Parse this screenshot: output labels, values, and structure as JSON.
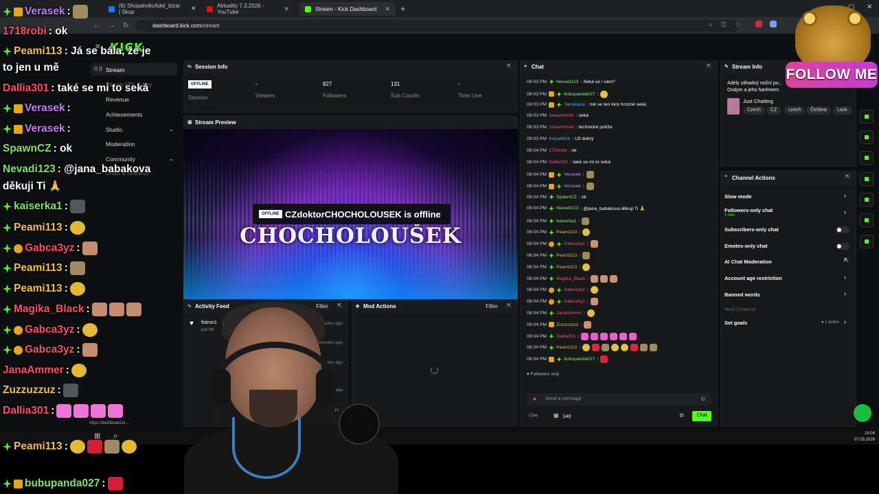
{
  "browser": {
    "tabs": [
      {
        "label": "(6) ShopaholicAdel_bizar | Skup",
        "active": false
      },
      {
        "label": "Aktuality 7.3.2026 - YouTube",
        "active": false
      },
      {
        "label": "Stream - Kick Dashboard",
        "active": true
      }
    ],
    "url_host": "dashboard.kick.com",
    "url_path": "/stream"
  },
  "sidebar": {
    "logo": "KICK",
    "items": [
      {
        "label": "Stream",
        "active": true
      },
      {
        "label": "Stream URL & Key"
      },
      {
        "label": "Revenue"
      },
      {
        "label": "Achievements"
      },
      {
        "label": "Studio"
      },
      {
        "label": "Moderation"
      },
      {
        "label": "Community"
      },
      {
        "label": "Drops & Rewards"
      }
    ],
    "link_preview": "https://dashboard.ki..."
  },
  "session_info": {
    "title": "Session Info",
    "status_badge": "OFFLINE",
    "session_label": "Session",
    "viewers_value": "-",
    "viewers_label": "Viewers",
    "followers_value": "827",
    "followers_label": "Followers",
    "subs_value": "131",
    "subs_label": "Sub Counts",
    "time_value": "-",
    "time_label": "Time Live"
  },
  "stream_preview": {
    "title": "Stream Preview",
    "overlay_title": "CHOCHOLOUŠEK",
    "offline_badge": "OFFLINE",
    "offline_text": "CZdoktorCHOCHOLOUSEK is offline"
  },
  "activity_feed": {
    "title": "Activity Feed",
    "filter": "Filter",
    "items": [
      {
        "name": "fistron1",
        "sub": "just foll",
        "time": "4 minutes ago"
      },
      {
        "name": "",
        "sub": "",
        "time": "6 minutes ago"
      },
      {
        "name": "",
        "sub": "",
        "time": "9 minutes ago"
      },
      {
        "name": "",
        "sub": "",
        "time": "19 minutes ago"
      },
      {
        "name": "",
        "sub": "",
        "time": "ago"
      }
    ]
  },
  "mod_actions": {
    "title": "Mod Actions",
    "filter": "Filter"
  },
  "chat": {
    "title": "Chat",
    "messages": [
      {
        "time": "08:03 PM",
        "user": "Nevadi123",
        "color": "#8cf06a",
        "text": ": Seká se i vám?"
      },
      {
        "time": "08:03 PM",
        "user": "bubupanda027",
        "color": "#8cf06a",
        "text": ":"
      },
      {
        "time": "08:03 PM",
        "user": "Tamalazia",
        "color": "#5aa7ff",
        "text": ": mě se ten kick hrozně seká"
      },
      {
        "time": "08:03 PM",
        "user": "JanaAmmer",
        "color": "#ff4e6a",
        "text": ": seká"
      },
      {
        "time": "08:03 PM",
        "user": "JanaAmmer",
        "color": "#ff4e6a",
        "text": ": technické potíže"
      },
      {
        "time": "08:03 PM",
        "user": "IndyaWick",
        "color": "#5aa7ff",
        "text": ": Už dobrý"
      },
      {
        "time": "08:04 PM",
        "user": "1718robi",
        "color": "#ff4e6a",
        "text": ": ok"
      },
      {
        "time": "08:04 PM",
        "user": "Dallia301",
        "color": "#ff4e6a",
        "text": ": také se mi to seká"
      },
      {
        "time": "08:04 PM",
        "user": "Verasek",
        "color": "#c18bff",
        "text": ":"
      },
      {
        "time": "08:04 PM",
        "user": "Verasek",
        "color": "#c18bff",
        "text": ":"
      },
      {
        "time": "08:04 PM",
        "user": "SpawnCZ",
        "color": "#8cf06a",
        "text": ": ok"
      },
      {
        "time": "08:04 PM",
        "user": "Nevadi123",
        "color": "#8cf06a",
        "text": ": @jana_babakova děkuji Ti 🙏"
      },
      {
        "time": "08:04 PM",
        "user": "kaiserka1",
        "color": "#8cf06a",
        "text": ":"
      },
      {
        "time": "08:04 PM",
        "user": "Peami113",
        "color": "#e6b84a",
        "text": ":"
      },
      {
        "time": "08:04 PM",
        "user": "Gabca3yz",
        "color": "#ff4e6a",
        "text": ":"
      },
      {
        "time": "08:04 PM",
        "user": "Peami113",
        "color": "#e6b84a",
        "text": ":"
      },
      {
        "time": "08:04 PM",
        "user": "Peami113",
        "color": "#e6b84a",
        "text": ":"
      },
      {
        "time": "08:04 PM",
        "user": "Magika_Black",
        "color": "#ff4e6a",
        "text": ":"
      },
      {
        "time": "08:04 PM",
        "user": "Gabca3yz",
        "color": "#ff4e6a",
        "text": ":"
      },
      {
        "time": "08:04 PM",
        "user": "Gabca3yz",
        "color": "#ff4e6a",
        "text": ":"
      },
      {
        "time": "08:04 PM",
        "user": "JanaAmmer",
        "color": "#ff4e6a",
        "text": ":"
      },
      {
        "time": "08:04 PM",
        "user": "Zuzzuzzuz",
        "color": "#e6b84a",
        "text": ":"
      },
      {
        "time": "08:04 PM",
        "user": "Dallia301",
        "color": "#ff4e6a",
        "text": ":"
      },
      {
        "time": "08:04 PM",
        "user": "Peami113",
        "color": "#e6b84a",
        "text": ":"
      },
      {
        "time": "08:04 PM",
        "user": "bubupanda027",
        "color": "#8cf06a",
        "text": ":"
      }
    ],
    "followers_only": "Followers only",
    "input_placeholder": "Send a message",
    "viewer_count": "140",
    "chat_button": "Chat"
  },
  "stream_info": {
    "title": "Stream Info",
    "stream_title": "Adély záhadný noční po... Ondym a jeho harémem",
    "category": "Just Chatting",
    "tags": [
      "Czech",
      "CZ",
      "czech",
      "Čeština",
      "Lock"
    ]
  },
  "channel_actions": {
    "title": "Channel Actions",
    "items": [
      {
        "label": "Slow mode",
        "kind": "chevron"
      },
      {
        "label": "Followers-only chat",
        "sub": "1 min",
        "kind": "chevron"
      },
      {
        "label": "Subscribers-only chat",
        "kind": "toggle"
      },
      {
        "label": "Emotes-only chat",
        "kind": "toggle"
      },
      {
        "label": "AI Chat Moderation",
        "kind": "external"
      },
      {
        "label": "Account age restriction",
        "kind": "chevron"
      },
      {
        "label": "Banned words",
        "kind": "chevron"
      },
      {
        "label": "Host Channel",
        "kind": "disabled"
      },
      {
        "label": "Set goals",
        "kind": "chevron",
        "badge": "1 active"
      }
    ]
  },
  "taskbar": {
    "time": "18:04",
    "date": "07.03.2026"
  },
  "overlay": {
    "follow_me": "FOLLOW ME",
    "lines": [
      {
        "user": "Verasek",
        "color": "#c47bff",
        "text": ":"
      },
      {
        "user": "1718robi",
        "color": "#ff4e6a",
        "text": ": ok"
      },
      {
        "user": "Peami113",
        "color": "#f2c14a",
        "text": ": Já se bála, že je"
      },
      {
        "user": "",
        "color": "#fff",
        "text": "to jen u mě"
      },
      {
        "user": "Dallia301",
        "color": "#ff4e6a",
        "text": ": také se mi to seká"
      },
      {
        "user": "Verasek",
        "color": "#c47bff",
        "text": ":"
      },
      {
        "user": "Verasek",
        "color": "#c47bff",
        "text": ":"
      },
      {
        "user": "SpawnCZ",
        "color": "#7de36b",
        "text": ": ok"
      },
      {
        "user": "Nevadi123",
        "color": "#7de36b",
        "text": ": @jana_babakova"
      },
      {
        "user": "",
        "color": "#fff",
        "text": "děkuji Ti 🙏"
      },
      {
        "user": "kaiserka1",
        "color": "#7de36b",
        "text": ":"
      },
      {
        "user": "Peami113",
        "color": "#f2c14a",
        "text": ":"
      },
      {
        "user": "Gabca3yz",
        "color": "#ff4e6a",
        "text": ":"
      },
      {
        "user": "Peami113",
        "color": "#f2c14a",
        "text": ":"
      },
      {
        "user": "Peami113",
        "color": "#f2c14a",
        "text": ":"
      },
      {
        "user": "Magika_Black",
        "color": "#ff4e6a",
        "text": ":"
      },
      {
        "user": "Gabca3yz",
        "color": "#ff4e6a",
        "text": ":"
      },
      {
        "user": "Gabca3yz",
        "color": "#ff4e6a",
        "text": ":"
      },
      {
        "user": "JanaAmmer",
        "color": "#ff4e6a",
        "text": ":"
      },
      {
        "user": "Zuzzuzzuz",
        "color": "#f2c14a",
        "text": ":"
      },
      {
        "user": "Dallia301",
        "color": "#ff4e6a",
        "text": ":"
      },
      {
        "user": "Peami113",
        "color": "#f2c14a",
        "text": ":"
      },
      {
        "user": "bubupanda027",
        "color": "#7de36b",
        "text": ":"
      }
    ]
  }
}
